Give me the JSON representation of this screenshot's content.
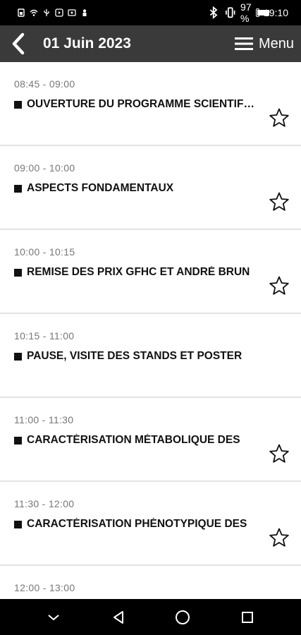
{
  "status_bar": {
    "battery_percent": "97 %",
    "time": "19:10",
    "battery_level": 0.97
  },
  "header": {
    "title": "01 Juin 2023",
    "menu_label": "Menu"
  },
  "sessions": [
    {
      "time": "08:45 - 09:00",
      "title": "OUVERTURE DU PROGRAMME SCIENTIFIQUE",
      "starrable": true
    },
    {
      "time": "09:00 - 10:00",
      "title": "ASPECTS FONDAMENTAUX",
      "starrable": true
    },
    {
      "time": "10:00 - 10:15",
      "title": "REMISE DES PRIX GFHC ET ANDRÉ BRUN",
      "starrable": true
    },
    {
      "time": "10:15 - 11:00",
      "title": "PAUSE, VISITE DES STANDS ET POSTER",
      "starrable": false
    },
    {
      "time": "11:00 - 11:30",
      "title": "CARACTÉRISATION MÉTABOLIQUE DES",
      "starrable": true
    },
    {
      "time": "11:30 - 12:00",
      "title": "CARACTÉRISATION PHÉNOTYPIQUE DES",
      "starrable": true
    },
    {
      "time": "12:00 - 13:00",
      "title": "",
      "starrable": false
    }
  ],
  "icons": {
    "back": "chevron-left-icon",
    "menu": "hamburger-icon",
    "star": "star-outline-icon",
    "nav_back": "triangle-back-icon",
    "nav_home": "circle-home-icon",
    "nav_recents": "square-recents-icon",
    "nav_hide": "chevron-down-icon"
  },
  "colors": {
    "app_bar": "#3a3a3a",
    "status_bar": "#000000",
    "time_text": "#777777",
    "title_text": "#111111",
    "divider": "#e3e3e3"
  }
}
